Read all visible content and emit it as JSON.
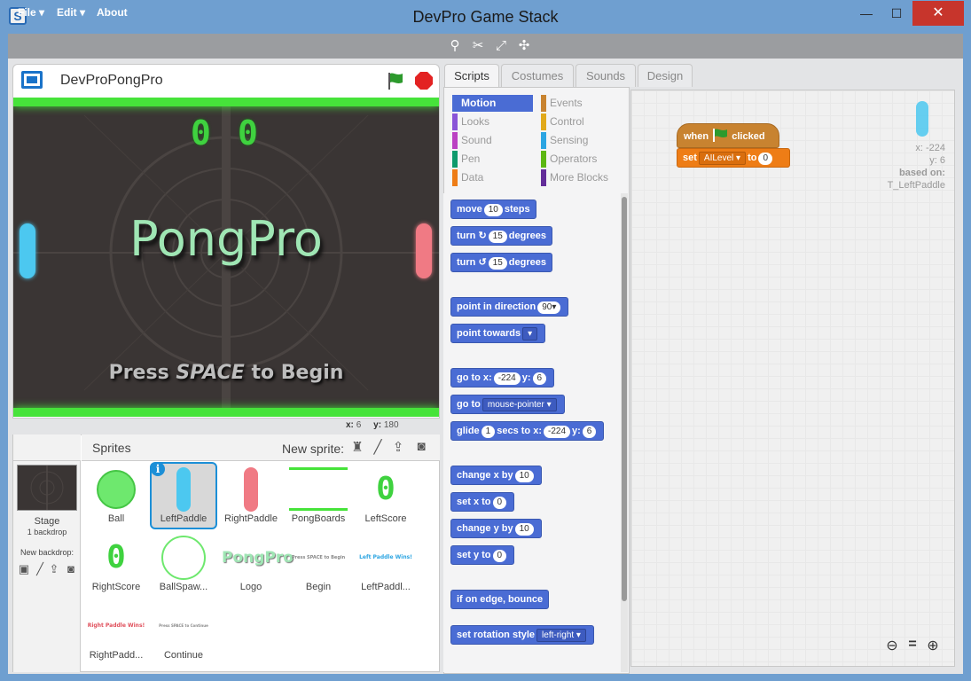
{
  "window": {
    "title": "DevPro Game Stack",
    "app_icon": "S",
    "minimize": "—",
    "maximize": "☐",
    "close": "✕"
  },
  "menu": {
    "file": "File ▾",
    "edit": "Edit ▾",
    "about": "About"
  },
  "toolbar_icons": [
    "duplicate-icon",
    "cut-icon",
    "grow-icon",
    "shrink-icon"
  ],
  "stage": {
    "project_title": "DevProPongPro",
    "score_left": "0",
    "score_right": "0",
    "logo_text": "PongPro",
    "press_prefix": "Press ",
    "press_key": "SPACE",
    "press_suffix": " to Begin",
    "x_label": "x:",
    "x_value": "6",
    "y_label": "y:",
    "y_value": "180"
  },
  "sprites_panel": {
    "title": "Sprites",
    "new_sprite_label": "New sprite:",
    "stage_label": "Stage",
    "backdrop_count": "1 backdrop",
    "new_backdrop_label": "New backdrop:",
    "items": [
      {
        "name": "Ball"
      },
      {
        "name": "LeftPaddle"
      },
      {
        "name": "RightPaddle"
      },
      {
        "name": "PongBoards"
      },
      {
        "name": "LeftScore"
      },
      {
        "name": "RightScore"
      },
      {
        "name": "BallSpaw..."
      },
      {
        "name": "Logo"
      },
      {
        "name": "Begin"
      },
      {
        "name": "LeftPaddl..."
      },
      {
        "name": "RightPadd..."
      },
      {
        "name": "Continue"
      }
    ],
    "thumb_texts": {
      "logo": "PongPro",
      "begin": "Press SPACE to Begin",
      "leftpaddle_win": "Left Paddle Wins!",
      "rightpaddle_win": "Right Paddle Wins!",
      "continue": "Press SPACE to Continue",
      "score": "0"
    }
  },
  "tabs": {
    "scripts": "Scripts",
    "costumes": "Costumes",
    "sounds": "Sounds",
    "design": "Design"
  },
  "categories": [
    {
      "label": "Motion",
      "color": "#4a6cd4"
    },
    {
      "label": "Events",
      "color": "#c88330"
    },
    {
      "label": "Looks",
      "color": "#8a55d7"
    },
    {
      "label": "Control",
      "color": "#e1a91a"
    },
    {
      "label": "Sound",
      "color": "#bb42c3"
    },
    {
      "label": "Sensing",
      "color": "#2ca5e2"
    },
    {
      "label": "Pen",
      "color": "#0e9a6c"
    },
    {
      "label": "Operators",
      "color": "#5cb712"
    },
    {
      "label": "Data",
      "color": "#ee7d16"
    },
    {
      "label": "More Blocks",
      "color": "#632d99"
    }
  ],
  "blocks": {
    "move": "move",
    "move_val": "10",
    "steps": "steps",
    "turn": "turn",
    "turn_val": "15",
    "degrees": "degrees",
    "point_dir": "point in direction",
    "point_dir_val": "90▾",
    "point_towards": "point towards",
    "point_towards_val": "▾",
    "goto": "go to x:",
    "goto_x": "-224",
    "goto_y_label": "y:",
    "goto_y": "6",
    "goto2": "go to",
    "goto2_val": "mouse-pointer ▾",
    "glide": "glide",
    "glide_secs": "1",
    "glide_mid": "secs to x:",
    "glide_x": "-224",
    "glide_y_label": "y:",
    "glide_y": "6",
    "change_x": "change x by",
    "change_x_val": "10",
    "set_x": "set x to",
    "set_x_val": "0",
    "change_y": "change y by",
    "change_y_val": "10",
    "set_y": "set y to",
    "set_y_val": "0",
    "bounce": "if on edge, bounce",
    "rot_style": "set rotation style",
    "rot_style_val": "left-right ▾"
  },
  "script": {
    "when": "when",
    "clicked": "clicked",
    "set": "set",
    "var": "AILevel ▾",
    "to": "to",
    "value": "0"
  },
  "sprite_info": {
    "x": "x: -224",
    "y": "y: 6",
    "based_on": "based on:",
    "based_name": "T_LeftPaddle"
  },
  "colors": {
    "paddle_left": "#4cc8f0",
    "paddle_right": "#f07a84",
    "board": "#46e33a",
    "motion": "#4a6cd4",
    "events": "#c88330",
    "data": "#ee7d16"
  }
}
